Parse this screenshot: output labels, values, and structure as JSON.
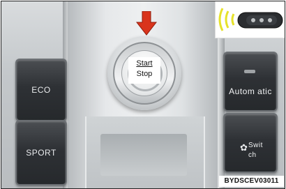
{
  "buttons": {
    "eco": "ECO",
    "sport": "SPORT",
    "automatic": "Autom atic",
    "switch": "Swit ch",
    "switch_icon": "fan-icon"
  },
  "start_stop": {
    "start": "Start",
    "stop": "Stop"
  },
  "arrow_color": "#d9341c",
  "inset": {
    "icon": "key-fob-icon"
  },
  "caption": "BYDSCEV03011"
}
